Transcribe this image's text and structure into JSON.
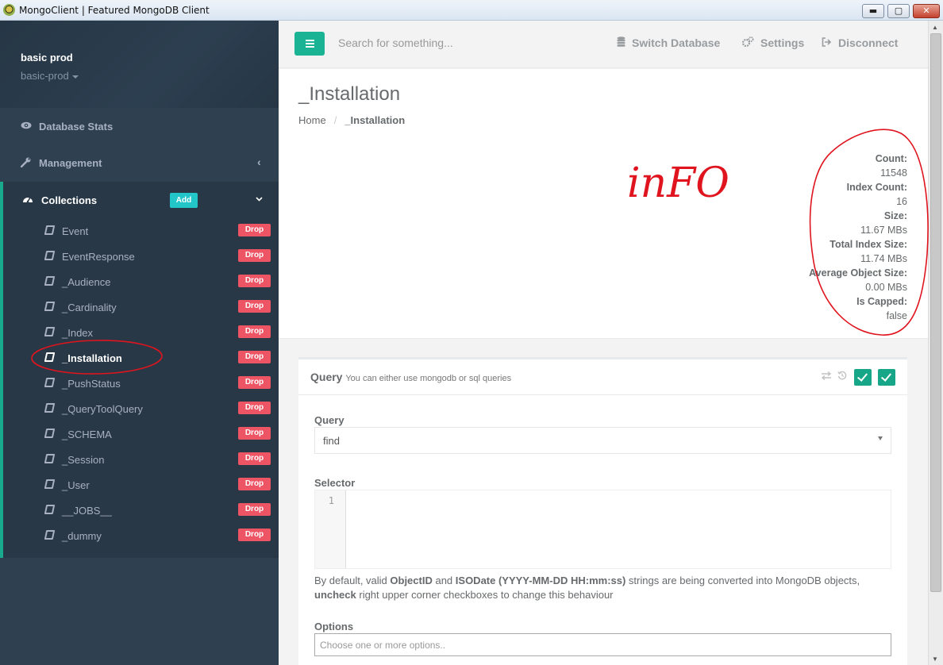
{
  "window": {
    "title": "MongoClient | Featured MongoDB Client",
    "min_label": "▬",
    "max_label": "▢",
    "close_label": "✕"
  },
  "profile": {
    "name": "basic prod",
    "db": "basic-prod"
  },
  "nav": {
    "stats_label": "Database Stats",
    "management_label": "Management",
    "collections_label": "Collections",
    "add_label": "Add",
    "collections": [
      {
        "name": "Event",
        "drop": "Drop"
      },
      {
        "name": "EventResponse",
        "drop": "Drop"
      },
      {
        "name": "_Audience",
        "drop": "Drop"
      },
      {
        "name": "_Cardinality",
        "drop": "Drop"
      },
      {
        "name": "_Index",
        "drop": "Drop"
      },
      {
        "name": "_Installation",
        "drop": "Drop"
      },
      {
        "name": "_PushStatus",
        "drop": "Drop"
      },
      {
        "name": "_QueryToolQuery",
        "drop": "Drop"
      },
      {
        "name": "_SCHEMA",
        "drop": "Drop"
      },
      {
        "name": "_Session",
        "drop": "Drop"
      },
      {
        "name": "_User",
        "drop": "Drop"
      },
      {
        "name": "__JOBS__",
        "drop": "Drop"
      },
      {
        "name": "_dummy",
        "drop": "Drop"
      }
    ],
    "active_collection": "_Installation"
  },
  "topbar": {
    "search_placeholder": "Search for something...",
    "switch_db": "Switch Database",
    "settings": "Settings",
    "disconnect": "Disconnect"
  },
  "page": {
    "title": "_Installation",
    "breadcrumb_home": "Home",
    "breadcrumb_separator": "/",
    "breadcrumb_current": "_Installation"
  },
  "stats": {
    "count_label": "Count:",
    "count": "11548",
    "index_count_label": "Index Count:",
    "index_count": "16",
    "size_label": "Size:",
    "size": "11.67 MBs",
    "total_index_size_label": "Total Index Size:",
    "total_index_size": "11.74 MBs",
    "avg_obj_size_label": "Average Object Size:",
    "avg_obj_size": "0.00 MBs",
    "capped_label": "Is Capped:",
    "capped": "false"
  },
  "annotation": {
    "text": "inFO"
  },
  "query": {
    "title": "Query",
    "subtitle": "You can either use mongodb or sql queries",
    "query_label": "Query",
    "query_value": "find",
    "selector_label": "Selector",
    "line_number": "1",
    "help_p1": "By default, valid ",
    "help_b1": "ObjectID",
    "help_p2": " and ",
    "help_b2": "ISODate (YYYY-MM-DD HH:mm:ss)",
    "help_p3": " strings are being converted into MongoDB objects,",
    "help_b3": "uncheck",
    "help_p4": " right upper corner checkboxes to change this behaviour",
    "options_label": "Options",
    "options_placeholder": "Choose one or more options.."
  },
  "colors": {
    "sidebar": "#2f4050",
    "accent": "#1ab394",
    "danger": "#ed5565",
    "info": "#23c6c8",
    "annotation": "#e0141e"
  }
}
